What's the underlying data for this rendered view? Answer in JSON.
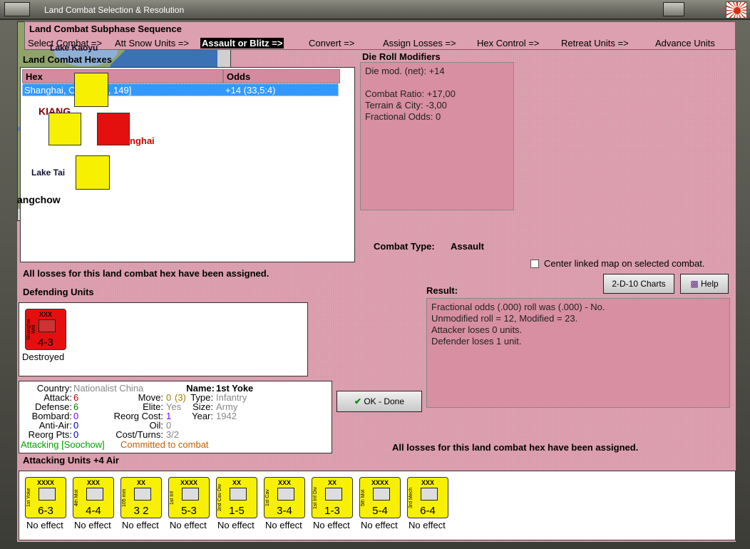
{
  "window": {
    "title": "Land Combat Selection & Resolution"
  },
  "sequence": {
    "title": "Land Combat Subphase Sequence",
    "steps": [
      "Select Combat =>",
      "Att Snow Units =>",
      "Assault or Blitz =>",
      "Convert =>",
      "Assign Losses =>",
      "Hex Control =>",
      "Retreat Units =>",
      "Advance Units"
    ],
    "active_index": 2
  },
  "hexes": {
    "title": "Land Combat Hexes",
    "col_hex": "Hex",
    "col_odds": "Odds",
    "rows": [
      {
        "hex": "Shanghai, China [81, 149]",
        "odds": "+14 (33,5:4)"
      }
    ]
  },
  "dmod": {
    "title": "Die Roll Modifiers",
    "lines": [
      "Die mod. (net): +14",
      "",
      "Combat Ratio: +17,00",
      "Terrain & City: -3,00",
      "Fractional Odds: 0"
    ]
  },
  "map": {
    "labels": [
      "Lake Kaoyu",
      "KIANG",
      "Lake Tai",
      "angchow",
      "nghai"
    ]
  },
  "combat_type": {
    "label": "Combat Type:",
    "value": "Assault"
  },
  "center_map": {
    "label": "Center linked map on selected combat.",
    "checked": false
  },
  "buttons": {
    "charts": "2-D-10 Charts",
    "help": "Help",
    "ok": "OK - Done"
  },
  "losses_msg": "All losses for this land combat hex have been assigned.",
  "defending": {
    "title": "Defending Units",
    "units": [
      {
        "name": "Shanghai Wtd",
        "size": "XXX",
        "str": "4-3",
        "status": "Destroyed"
      }
    ]
  },
  "result": {
    "title": "Result:",
    "lines": [
      "Fractional odds (.000) roll was (.000)  - No.",
      "Unmodified roll = 12, Modified = 23.",
      "Attacker loses 0 units.",
      "Defender loses 1 unit."
    ]
  },
  "info": {
    "country_k": "Country:",
    "country": "Nationalist China",
    "name_k": "Name:",
    "name": "1st Yoke",
    "attack_k": "Attack:",
    "attack": "6",
    "move_k": "Move:",
    "move": "0",
    "move2": "(3)",
    "type_k": "Type:",
    "type": "Infantry",
    "defense_k": "Defense:",
    "defense": "6",
    "elite_k": "Elite:",
    "elite": "Yes",
    "size_k": "Size:",
    "size": "Army",
    "bombard_k": "Bombard:",
    "bombard": "0",
    "reorg_k": "Reorg Cost:",
    "reorg": "1",
    "year_k": "Year:",
    "year": "1942",
    "aa_k": "Anti-Air:",
    "aa": "0",
    "oil_k": "Oil:",
    "oil": "0",
    "rpts_k": "Reorg Pts:",
    "rpts": "0",
    "cost_k": "Cost/Turns:",
    "cost": "3/2",
    "attacking": "Attacking [Soochow]",
    "committed": "Committed to combat"
  },
  "attacking": {
    "title": "Attacking Units +4 Air",
    "units": [
      {
        "name": "1st Yoke",
        "size": "XXXX",
        "str": "6-3",
        "status": "No effect"
      },
      {
        "name": "4th Mot",
        "size": "XXX",
        "str": "4-4",
        "status": "No effect"
      },
      {
        "name": "105 mm",
        "size": "XX",
        "str": "3 2",
        "status": "No effect"
      },
      {
        "name": "1st Inf",
        "size": "XXXX",
        "str": "5-3",
        "status": "No effect"
      },
      {
        "name": "2nd Cav Div",
        "size": "XX",
        "str": "1-5",
        "status": "No effect"
      },
      {
        "name": "1st Cav",
        "size": "XXX",
        "str": "3-4",
        "status": "No effect"
      },
      {
        "name": "1st Inf Div",
        "size": "XX",
        "str": "1-3",
        "status": "No effect"
      },
      {
        "name": "5th Mot",
        "size": "XXXX",
        "str": "5-4",
        "status": "No effect"
      },
      {
        "name": "3rd Mech",
        "size": "XXX",
        "str": "6-4",
        "status": "No effect"
      }
    ]
  },
  "colors": {
    "bg": "#d99aab",
    "selected": "#3399ff",
    "attack": "#c00000",
    "defense": "#008000",
    "purple": "#8000ff",
    "blue": "#0000c0",
    "orange": "#c06000",
    "green": "#00a000"
  }
}
